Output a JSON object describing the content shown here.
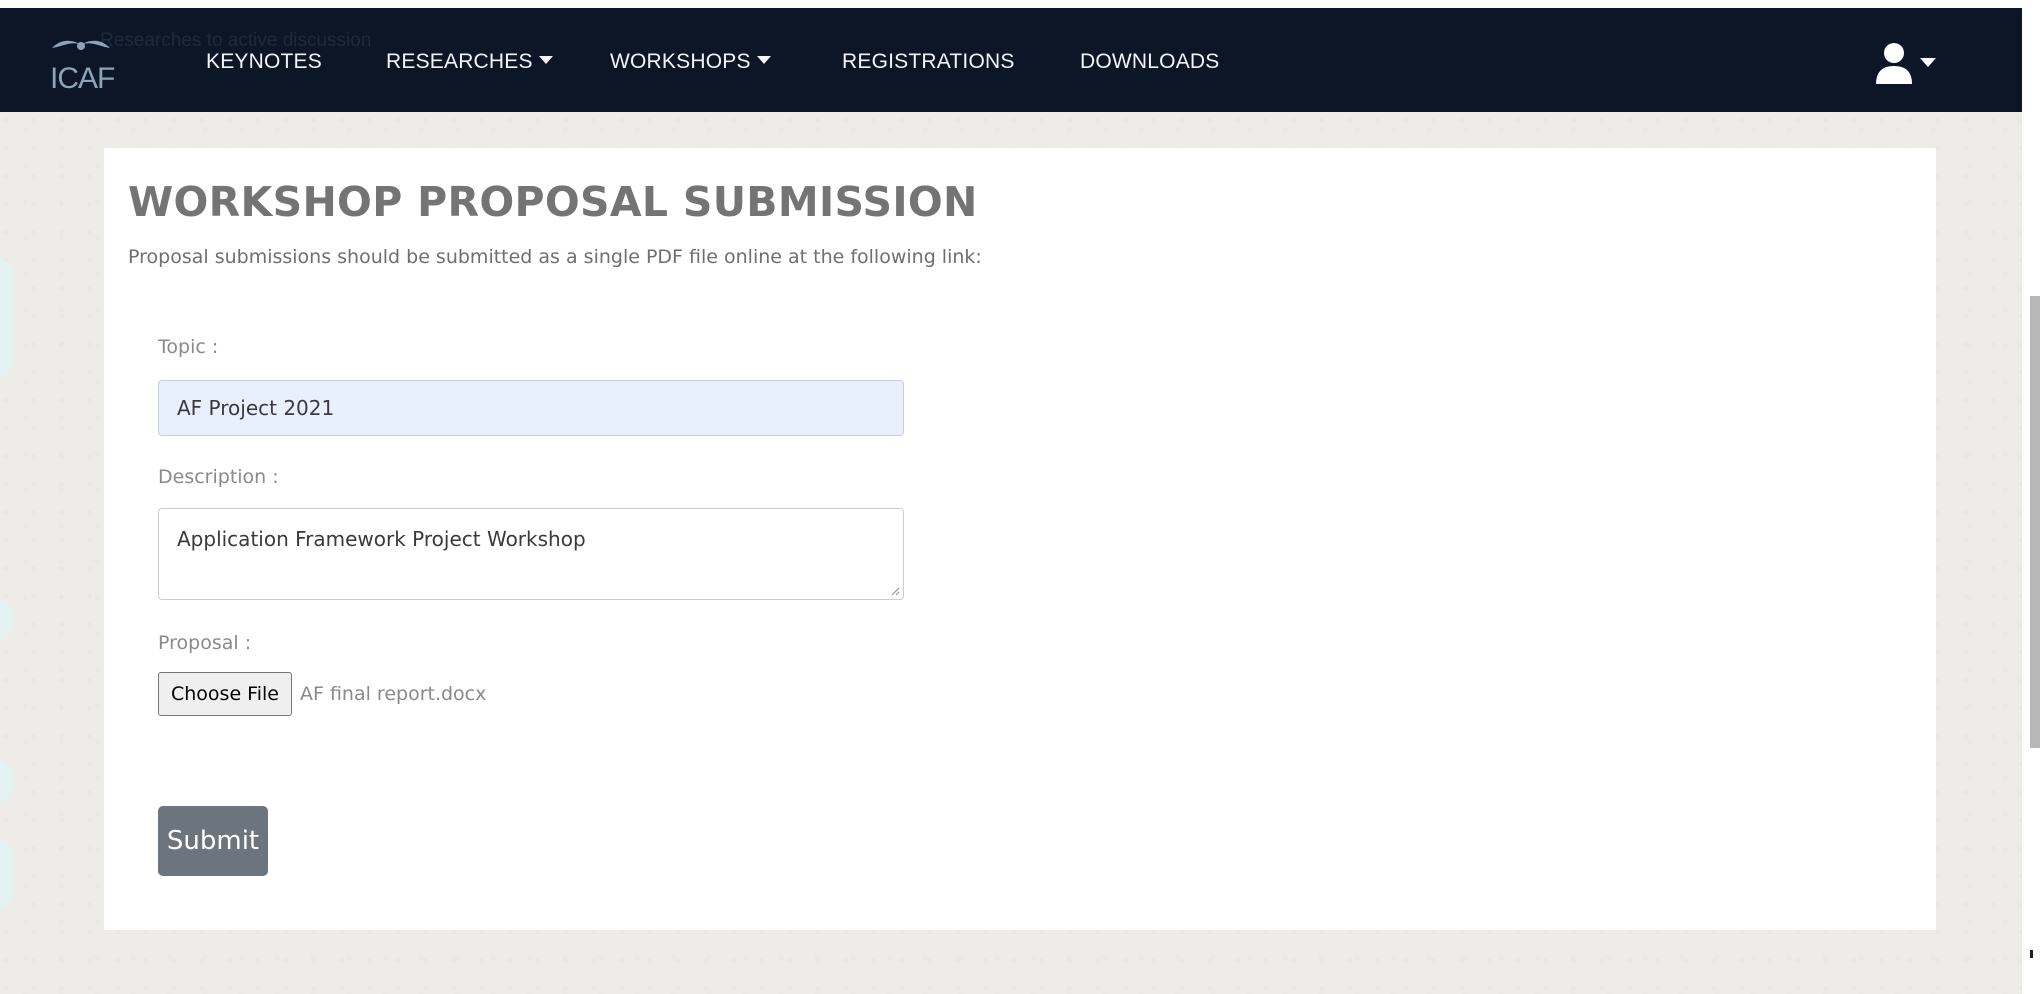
{
  "navbar": {
    "logo_text": "ICAF",
    "ghost_text": "Researches to active discussion",
    "items": [
      {
        "label": "KEYNOTES",
        "has_dropdown": false
      },
      {
        "label": "RESEARCHES",
        "has_dropdown": true
      },
      {
        "label": "WORKSHOPS",
        "has_dropdown": true
      },
      {
        "label": "REGISTRATIONS",
        "has_dropdown": false
      },
      {
        "label": "DOWNLOADS",
        "has_dropdown": false
      }
    ],
    "user_icon": "user-icon"
  },
  "form": {
    "title": "WORKSHOP PROPOSAL SUBMISSION",
    "subtitle": "Proposal submissions should be submitted as a single PDF file online at the following link:",
    "topic_label": "Topic :",
    "topic_value": "AF Project 2021",
    "description_label": "Description :",
    "description_value": "Application Framework Project Workshop",
    "proposal_label": "Proposal :",
    "file_button_label": "Choose File",
    "file_name": "AF final report.docx",
    "submit_label": "Submit"
  },
  "colors": {
    "navbar_bg": "#0c1627",
    "page_bg": "#eeece8",
    "card_bg": "#ffffff",
    "topic_autofill_bg": "#e8f0fe",
    "submit_bg": "#6c757d",
    "title_color": "#747474"
  }
}
